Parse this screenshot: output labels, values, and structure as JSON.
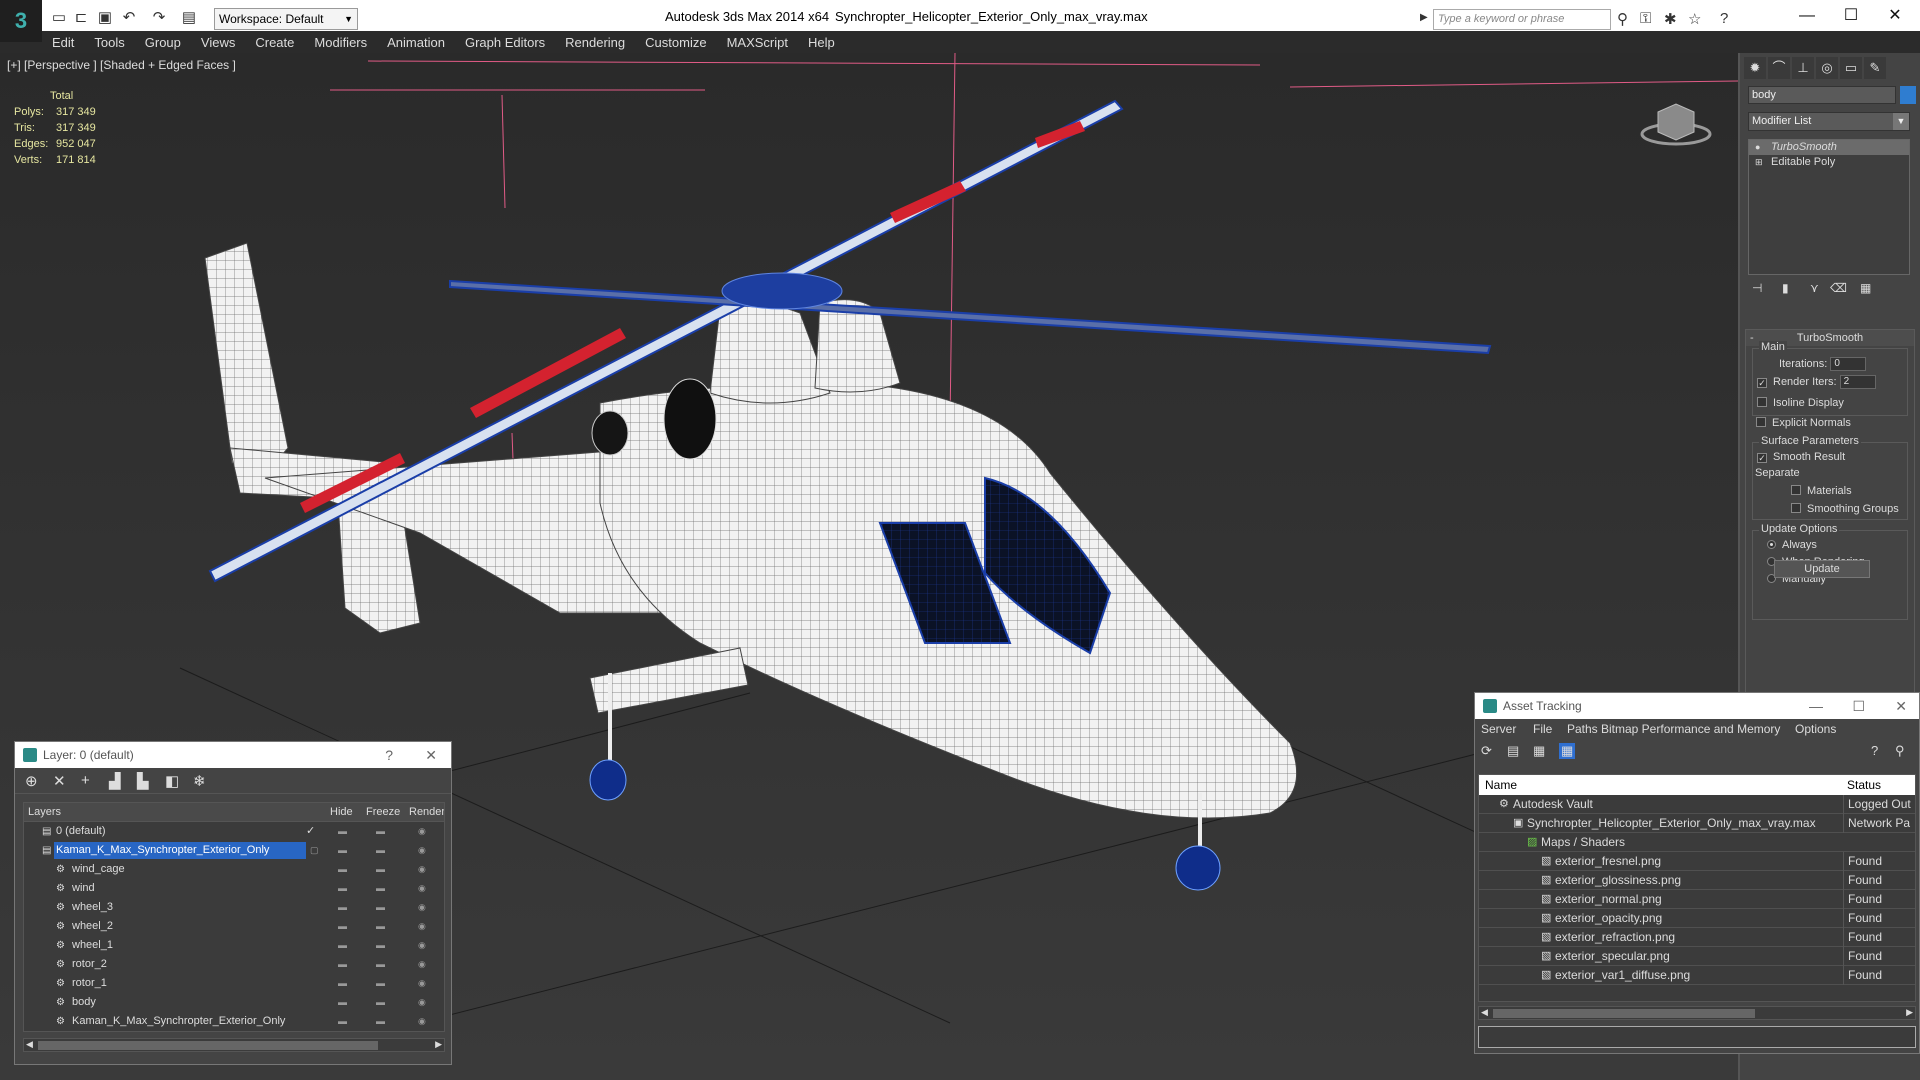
{
  "window": {
    "app_title": "Autodesk 3ds Max  2014 x64",
    "doc_title": "Synchropter_Helicopter_Exterior_Only_max_vray.max",
    "workspace": "Workspace: Default",
    "search_placeholder": "Type a keyword or phrase"
  },
  "menu": [
    "Edit",
    "Tools",
    "Group",
    "Views",
    "Create",
    "Modifiers",
    "Animation",
    "Graph Editors",
    "Rendering",
    "Customize",
    "MAXScript",
    "Help"
  ],
  "viewport": {
    "label": "[+] [Perspective ] [Shaded + Edged Faces ]",
    "stats": {
      "header": "Total",
      "rows": [
        {
          "k": "Polys:",
          "v": "317 349"
        },
        {
          "k": "Tris:",
          "v": "317 349"
        },
        {
          "k": "Edges:",
          "v": "952 047"
        },
        {
          "k": "Verts:",
          "v": "171 814"
        }
      ]
    }
  },
  "command_panel": {
    "object_name": "body",
    "object_color": "#2f7dd0",
    "modifier_list": "Modifier List",
    "stack": [
      "TurboSmooth",
      "Editable Poly"
    ],
    "turbosmooth": {
      "title": "TurboSmooth",
      "main": "Main",
      "iterations_label": "Iterations:",
      "iterations": "0",
      "render_iters_label": "Render Iters:",
      "render_iters": "2",
      "isoline": "Isoline Display",
      "explicit_normals": "Explicit Normals",
      "surface_params": "Surface Parameters",
      "smooth_result": "Smooth Result",
      "separate": "Separate",
      "materials": "Materials",
      "smoothing_groups": "Smoothing Groups",
      "update_options": "Update Options",
      "always": "Always",
      "when_rendering": "When Rendering",
      "manually": "Manually",
      "update": "Update"
    }
  },
  "layer_dialog": {
    "title": "Layer: 0 (default)",
    "help": "?",
    "close": "✕",
    "columns": {
      "layers": "Layers",
      "hide": "Hide",
      "freeze": "Freeze",
      "render": "Render"
    },
    "rows": [
      "0 (default)",
      "Kaman_K_Max_Synchropter_Exterior_Only",
      "wind_cage",
      "wind",
      "wheel_3",
      "wheel_2",
      "wheel_1",
      "rotor_2",
      "rotor_1",
      "body",
      "Kaman_K_Max_Synchropter_Exterior_Only"
    ]
  },
  "asset_dialog": {
    "title": "Asset Tracking",
    "menu": [
      "Server",
      "File",
      "Paths",
      "Bitmap Performance and Memory",
      "Options"
    ],
    "columns": {
      "name": "Name",
      "status": "Status"
    },
    "rows": [
      {
        "name": "Autodesk Vault",
        "status": "Logged Out"
      },
      {
        "name": "Synchropter_Helicopter_Exterior_Only_max_vray.max",
        "status": "Network Pa"
      },
      {
        "name": "Maps / Shaders",
        "status": ""
      },
      {
        "name": "exterior_fresnel.png",
        "status": "Found"
      },
      {
        "name": "exterior_glossiness.png",
        "status": "Found"
      },
      {
        "name": "exterior_normal.png",
        "status": "Found"
      },
      {
        "name": "exterior_opacity.png",
        "status": "Found"
      },
      {
        "name": "exterior_refraction.png",
        "status": "Found"
      },
      {
        "name": "exterior_specular.png",
        "status": "Found"
      },
      {
        "name": "exterior_var1_diffuse.png",
        "status": "Found"
      }
    ]
  }
}
